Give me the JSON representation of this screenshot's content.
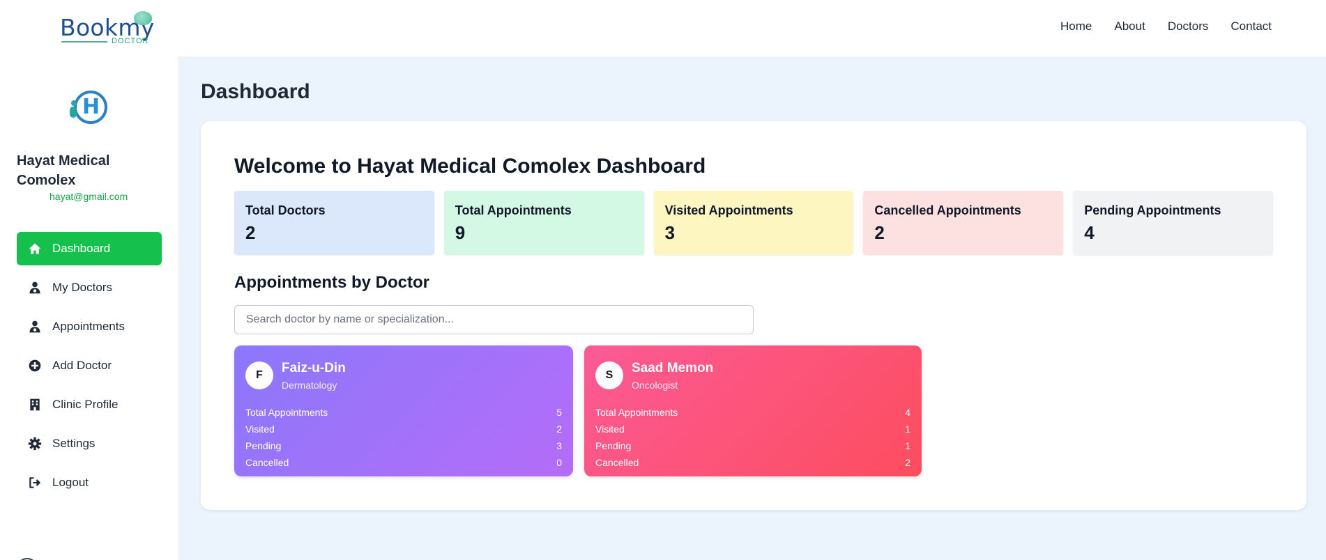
{
  "brand": {
    "name": "Bookmy",
    "sub": "DOCTOR"
  },
  "nav": {
    "items": [
      "Home",
      "About",
      "Doctors",
      "Contact"
    ]
  },
  "sidebar": {
    "clinic_name": "Hayat Medical Comolex",
    "clinic_email": "hayat@gmail.com",
    "items": [
      {
        "label": "Dashboard",
        "icon": "home-icon",
        "active": true
      },
      {
        "label": "My Doctors",
        "icon": "doctor-icon"
      },
      {
        "label": "Appointments",
        "icon": "doctor-icon"
      },
      {
        "label": "Add Doctor",
        "icon": "plus-circle-icon"
      },
      {
        "label": "Clinic Profile",
        "icon": "building-icon"
      },
      {
        "label": "Settings",
        "icon": "gear-icon"
      },
      {
        "label": "Logout",
        "icon": "logout-icon"
      }
    ]
  },
  "main": {
    "title": "Dashboard",
    "welcome": "Welcome to Hayat Medical Comolex Dashboard",
    "stats": [
      {
        "label": "Total Doctors",
        "value": "2",
        "color": "#dbe8fc"
      },
      {
        "label": "Total Appointments",
        "value": "9",
        "color": "#d3f8e4"
      },
      {
        "label": "Visited Appointments",
        "value": "3",
        "color": "#fdf6c0"
      },
      {
        "label": "Cancelled Appointments",
        "value": "2",
        "color": "#fde0e0"
      },
      {
        "label": "Pending Appointments",
        "value": "4",
        "color": "#f1f2f4"
      }
    ],
    "section_title": "Appointments by Doctor",
    "search_placeholder": "Search doctor by name or specialization...",
    "doctors": [
      {
        "initial": "F",
        "name": "Faiz-u-Din",
        "specialization": "Dermatology",
        "rows": [
          {
            "label": "Total Appointments",
            "value": "5"
          },
          {
            "label": "Visited",
            "value": "2"
          },
          {
            "label": "Pending",
            "value": "3"
          },
          {
            "label": "Cancelled",
            "value": "0"
          }
        ]
      },
      {
        "initial": "S",
        "name": "Saad Memon",
        "specialization": "Oncologist",
        "rows": [
          {
            "label": "Total Appointments",
            "value": "4"
          },
          {
            "label": "Visited",
            "value": "1"
          },
          {
            "label": "Pending",
            "value": "1"
          },
          {
            "label": "Cancelled",
            "value": "2"
          }
        ]
      }
    ]
  }
}
